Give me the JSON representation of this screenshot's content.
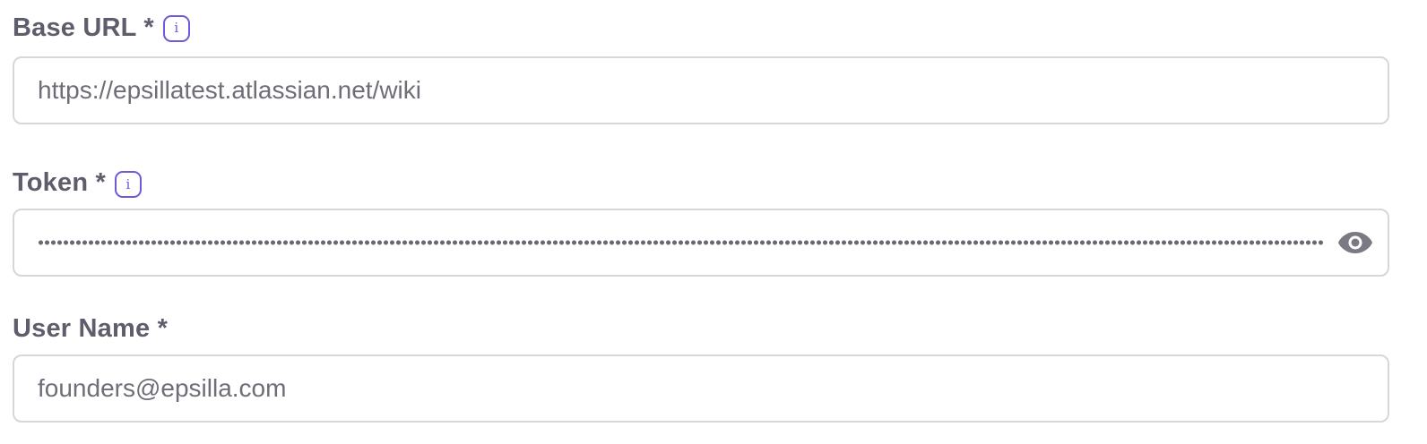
{
  "form": {
    "base_url": {
      "label": "Base URL *",
      "value": "https://epsillatest.atlassian.net/wiki",
      "info_icon": "info-icon"
    },
    "token": {
      "label": "Token *",
      "value": "••••••••••••••••••••••••••••••••••••••••••••••••••••",
      "masked": true,
      "info_icon": "info-icon",
      "toggle_icon": "eye-icon"
    },
    "user_name": {
      "label": "User Name *",
      "value": "founders@epsilla.com"
    }
  },
  "colors": {
    "accent": "#6b5cd6",
    "label_text": "#5d5d6c",
    "input_text": "#6e6e78",
    "border": "#d7d7db"
  }
}
